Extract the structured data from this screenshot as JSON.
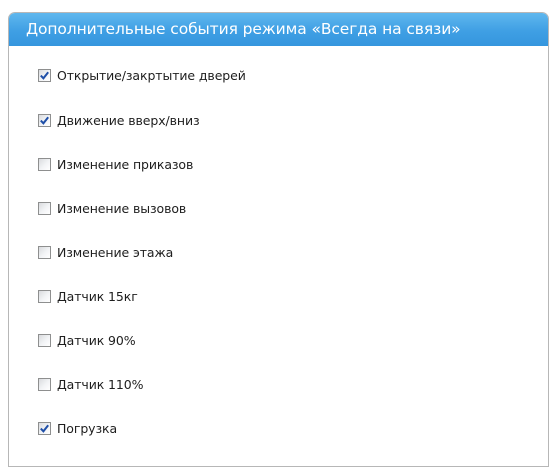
{
  "panel": {
    "title": "Дополнительные события режима «Всегда на связи»"
  },
  "options": [
    {
      "label": "Открытие/закртытие дверей",
      "checked": true
    },
    {
      "label": "Движение вверх/вниз",
      "checked": true
    },
    {
      "label": "Изменение приказов",
      "checked": false
    },
    {
      "label": "Изменение вызовов",
      "checked": false
    },
    {
      "label": "Изменение этажа",
      "checked": false
    },
    {
      "label": "Датчик 15кг",
      "checked": false
    },
    {
      "label": "Датчик 90%",
      "checked": false
    },
    {
      "label": "Датчик 110%",
      "checked": false
    },
    {
      "label": "Погрузка",
      "checked": true
    }
  ],
  "colors": {
    "header": "#3f9fe4",
    "check": "#1f4fa8"
  },
  "icons": {
    "checkbox": "checkbox-icon",
    "check_mark": "checkmark-icon"
  }
}
